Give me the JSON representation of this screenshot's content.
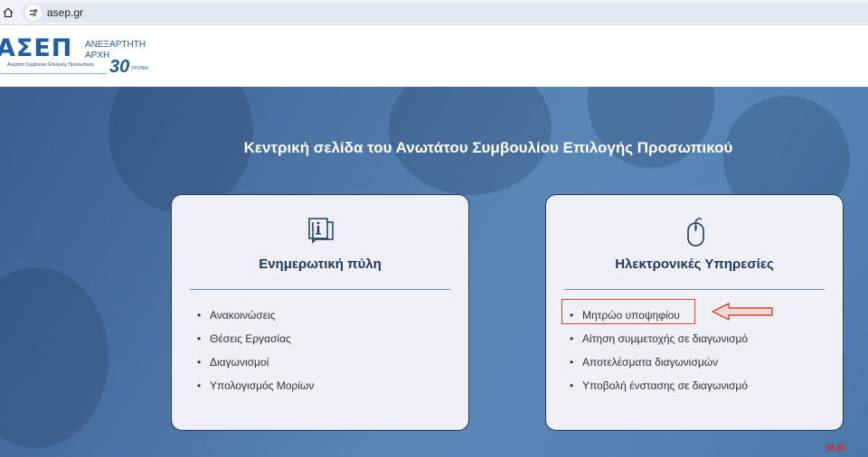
{
  "browser": {
    "url": "asep.gr",
    "icons": [
      "home-icon",
      "site-info-icon"
    ]
  },
  "header": {
    "logo_text": "ΑΣΕΠ",
    "logo_subtitle": "Ανώτατο Συμβούλιο Επιλογής Προσωπικού",
    "independent_line1": "ΑΝΕΞΑΡΤΗΤΗ",
    "independent_line2": "ΑΡΧΗ",
    "anniversary_number": "30",
    "anniversary_word": "ΧΡΟΝΙΑ"
  },
  "hero": {
    "title": "Κεντρική σελίδα του Ανωτάτου Συμβουλίου Επιλογής Προσωπικού"
  },
  "cards": [
    {
      "icon": "info-book-icon",
      "title": "Ενημερωτική πύλη",
      "items": [
        "Ανακοινώσεις",
        "Θέσεις Εργασίας",
        "Διαγωνισμοί",
        "Υπολογισμός Μορίων"
      ]
    },
    {
      "icon": "mouse-icon",
      "title": "Ηλεκτρονικές Υπηρεσίες",
      "items": [
        "Μητρώο υποψηφίου",
        "Αίτηση συμμετοχής σε διαγωνισμό",
        "Αποτελέσματα διαγωνισμών",
        "Υποβολή ένστασης σε διαγωνισμό"
      ]
    }
  ],
  "annotation": {
    "highlight_color": "#d9442f",
    "signature": "M.M."
  }
}
